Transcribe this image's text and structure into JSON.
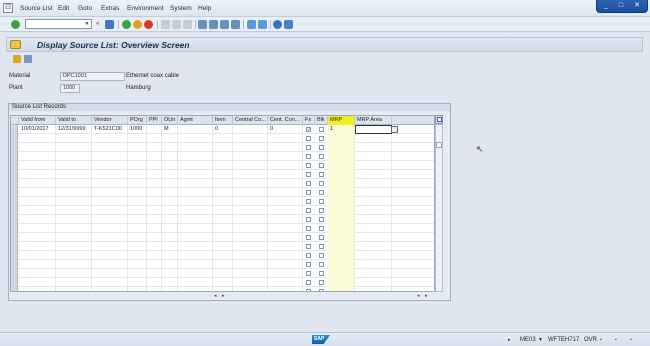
{
  "menubar": {
    "items": [
      "Source List",
      "Edit",
      "Goto",
      "Extras",
      "Environment",
      "System",
      "Help"
    ]
  },
  "toolbar": {
    "command_value": ""
  },
  "title": "Display Source List: Overview Screen",
  "header": {
    "material_label": "Material",
    "material_value": "DPC1001",
    "material_desc": "Ethernet coax cable",
    "plant_label": "Plant",
    "plant_value": "1000",
    "plant_desc": "Hamburg"
  },
  "group_title": "Source List Records",
  "table": {
    "columns": [
      "Valid from",
      "Valid to",
      "Vendor",
      "POrg",
      "PPl",
      "OUn",
      "Agmt",
      "Item",
      "Central Co...",
      "Cent. Con...",
      "Fx",
      "Blk",
      "MRP",
      "MRP Area"
    ],
    "rows": [
      {
        "valid_from": "10/01/2017",
        "valid_to": "12/31/9999",
        "vendor": "T-K521C00",
        "porg": "1000",
        "ppl": "",
        "oun": "M",
        "agmt": "",
        "item": "0",
        "central_co": "",
        "cent_con": "0",
        "fx": "✓",
        "blk": "",
        "mrp": "1",
        "mrp_area": ""
      }
    ]
  },
  "statusbar": {
    "transaction": "ME03",
    "server": "WFTEH717",
    "mode": "OVR",
    "logo": "SAP"
  }
}
